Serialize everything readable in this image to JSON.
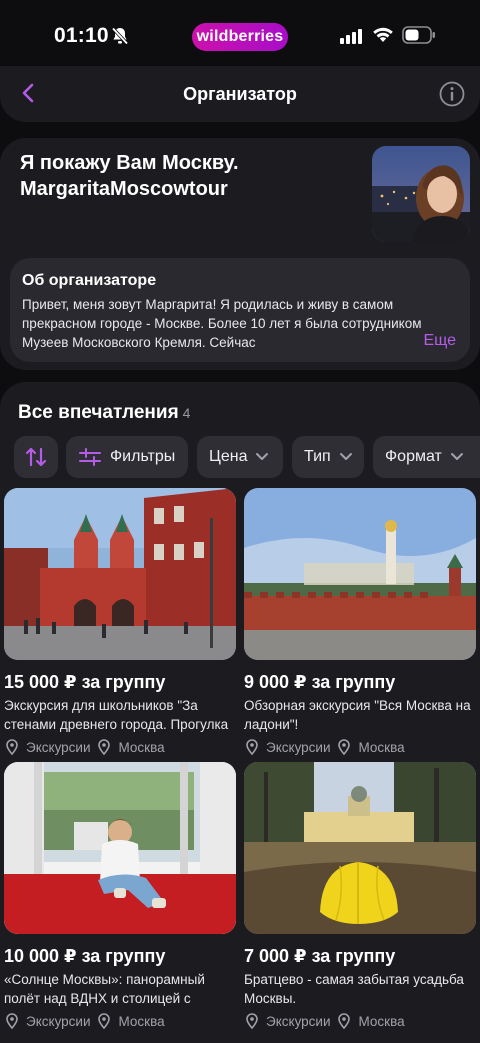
{
  "status_bar": {
    "time": "01:10",
    "brand": "wildberries"
  },
  "nav": {
    "title": "Организатор"
  },
  "organizer": {
    "name": "Я покажу Вам Москву. MargaritaMoscowtour",
    "about_title": "Об организаторе",
    "about_text": "Привет, меня зовут Маргарита! Я родилась и живу в самом прекрасном городе - Москве. Более 10 лет я была сотрудником Музеев Московского Кремля. Сейчас",
    "more_label": "Еще"
  },
  "section": {
    "title": "Все впечатления",
    "count": "4",
    "filters": {
      "sort_icon": "sort-arrows-icon",
      "filters_label": "Фильтры",
      "price_label": "Цена",
      "type_label": "Тип",
      "format_label": "Формат"
    }
  },
  "cards": [
    {
      "price": "15 000 ₽ за группу",
      "description": "Экскурсия для школьников \"За стенами древнего города. Прогулка",
      "category": "Экскурсии",
      "city": "Москва"
    },
    {
      "price": "9 000 ₽ за группу",
      "description": "Обзорная экскурсия \"Вся Москва на ладони\"!",
      "category": "Экскурсии",
      "city": "Москва"
    },
    {
      "price": "10 000 ₽ за группу",
      "description": "«Солнце Москвы»: панорамный полёт над ВДНХ и столицей с экскурсией",
      "category": "Экскурсии",
      "city": "Москва"
    },
    {
      "price": "7 000 ₽ за группу",
      "description": "Братцево - самая забытая усадьба Москвы.",
      "category": "Экскурсии",
      "city": "Москва"
    }
  ],
  "colors": {
    "accent": "#b55ce6",
    "brand_gradient_start": "#cb11ab",
    "brand_gradient_end": "#a80dc9",
    "background": "#0d0d10",
    "card": "#1c1b20",
    "chip": "#2f2e35"
  }
}
